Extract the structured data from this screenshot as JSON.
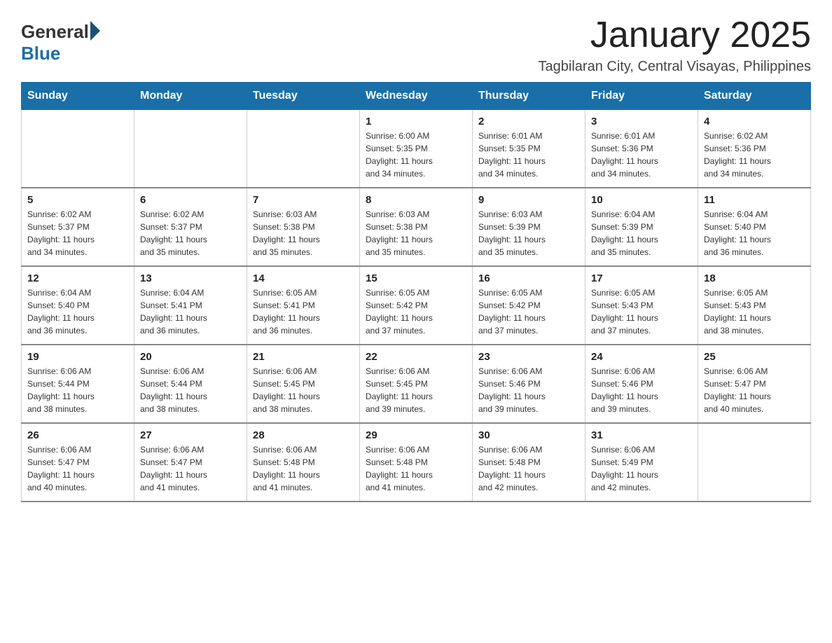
{
  "logo": {
    "general": "General",
    "blue": "Blue"
  },
  "title": "January 2025",
  "subtitle": "Tagbilaran City, Central Visayas, Philippines",
  "days_of_week": [
    "Sunday",
    "Monday",
    "Tuesday",
    "Wednesday",
    "Thursday",
    "Friday",
    "Saturday"
  ],
  "weeks": [
    [
      {
        "day": "",
        "info": ""
      },
      {
        "day": "",
        "info": ""
      },
      {
        "day": "",
        "info": ""
      },
      {
        "day": "1",
        "info": "Sunrise: 6:00 AM\nSunset: 5:35 PM\nDaylight: 11 hours\nand 34 minutes."
      },
      {
        "day": "2",
        "info": "Sunrise: 6:01 AM\nSunset: 5:35 PM\nDaylight: 11 hours\nand 34 minutes."
      },
      {
        "day": "3",
        "info": "Sunrise: 6:01 AM\nSunset: 5:36 PM\nDaylight: 11 hours\nand 34 minutes."
      },
      {
        "day": "4",
        "info": "Sunrise: 6:02 AM\nSunset: 5:36 PM\nDaylight: 11 hours\nand 34 minutes."
      }
    ],
    [
      {
        "day": "5",
        "info": "Sunrise: 6:02 AM\nSunset: 5:37 PM\nDaylight: 11 hours\nand 34 minutes."
      },
      {
        "day": "6",
        "info": "Sunrise: 6:02 AM\nSunset: 5:37 PM\nDaylight: 11 hours\nand 35 minutes."
      },
      {
        "day": "7",
        "info": "Sunrise: 6:03 AM\nSunset: 5:38 PM\nDaylight: 11 hours\nand 35 minutes."
      },
      {
        "day": "8",
        "info": "Sunrise: 6:03 AM\nSunset: 5:38 PM\nDaylight: 11 hours\nand 35 minutes."
      },
      {
        "day": "9",
        "info": "Sunrise: 6:03 AM\nSunset: 5:39 PM\nDaylight: 11 hours\nand 35 minutes."
      },
      {
        "day": "10",
        "info": "Sunrise: 6:04 AM\nSunset: 5:39 PM\nDaylight: 11 hours\nand 35 minutes."
      },
      {
        "day": "11",
        "info": "Sunrise: 6:04 AM\nSunset: 5:40 PM\nDaylight: 11 hours\nand 36 minutes."
      }
    ],
    [
      {
        "day": "12",
        "info": "Sunrise: 6:04 AM\nSunset: 5:40 PM\nDaylight: 11 hours\nand 36 minutes."
      },
      {
        "day": "13",
        "info": "Sunrise: 6:04 AM\nSunset: 5:41 PM\nDaylight: 11 hours\nand 36 minutes."
      },
      {
        "day": "14",
        "info": "Sunrise: 6:05 AM\nSunset: 5:41 PM\nDaylight: 11 hours\nand 36 minutes."
      },
      {
        "day": "15",
        "info": "Sunrise: 6:05 AM\nSunset: 5:42 PM\nDaylight: 11 hours\nand 37 minutes."
      },
      {
        "day": "16",
        "info": "Sunrise: 6:05 AM\nSunset: 5:42 PM\nDaylight: 11 hours\nand 37 minutes."
      },
      {
        "day": "17",
        "info": "Sunrise: 6:05 AM\nSunset: 5:43 PM\nDaylight: 11 hours\nand 37 minutes."
      },
      {
        "day": "18",
        "info": "Sunrise: 6:05 AM\nSunset: 5:43 PM\nDaylight: 11 hours\nand 38 minutes."
      }
    ],
    [
      {
        "day": "19",
        "info": "Sunrise: 6:06 AM\nSunset: 5:44 PM\nDaylight: 11 hours\nand 38 minutes."
      },
      {
        "day": "20",
        "info": "Sunrise: 6:06 AM\nSunset: 5:44 PM\nDaylight: 11 hours\nand 38 minutes."
      },
      {
        "day": "21",
        "info": "Sunrise: 6:06 AM\nSunset: 5:45 PM\nDaylight: 11 hours\nand 38 minutes."
      },
      {
        "day": "22",
        "info": "Sunrise: 6:06 AM\nSunset: 5:45 PM\nDaylight: 11 hours\nand 39 minutes."
      },
      {
        "day": "23",
        "info": "Sunrise: 6:06 AM\nSunset: 5:46 PM\nDaylight: 11 hours\nand 39 minutes."
      },
      {
        "day": "24",
        "info": "Sunrise: 6:06 AM\nSunset: 5:46 PM\nDaylight: 11 hours\nand 39 minutes."
      },
      {
        "day": "25",
        "info": "Sunrise: 6:06 AM\nSunset: 5:47 PM\nDaylight: 11 hours\nand 40 minutes."
      }
    ],
    [
      {
        "day": "26",
        "info": "Sunrise: 6:06 AM\nSunset: 5:47 PM\nDaylight: 11 hours\nand 40 minutes."
      },
      {
        "day": "27",
        "info": "Sunrise: 6:06 AM\nSunset: 5:47 PM\nDaylight: 11 hours\nand 41 minutes."
      },
      {
        "day": "28",
        "info": "Sunrise: 6:06 AM\nSunset: 5:48 PM\nDaylight: 11 hours\nand 41 minutes."
      },
      {
        "day": "29",
        "info": "Sunrise: 6:06 AM\nSunset: 5:48 PM\nDaylight: 11 hours\nand 41 minutes."
      },
      {
        "day": "30",
        "info": "Sunrise: 6:06 AM\nSunset: 5:48 PM\nDaylight: 11 hours\nand 42 minutes."
      },
      {
        "day": "31",
        "info": "Sunrise: 6:06 AM\nSunset: 5:49 PM\nDaylight: 11 hours\nand 42 minutes."
      },
      {
        "day": "",
        "info": ""
      }
    ]
  ]
}
